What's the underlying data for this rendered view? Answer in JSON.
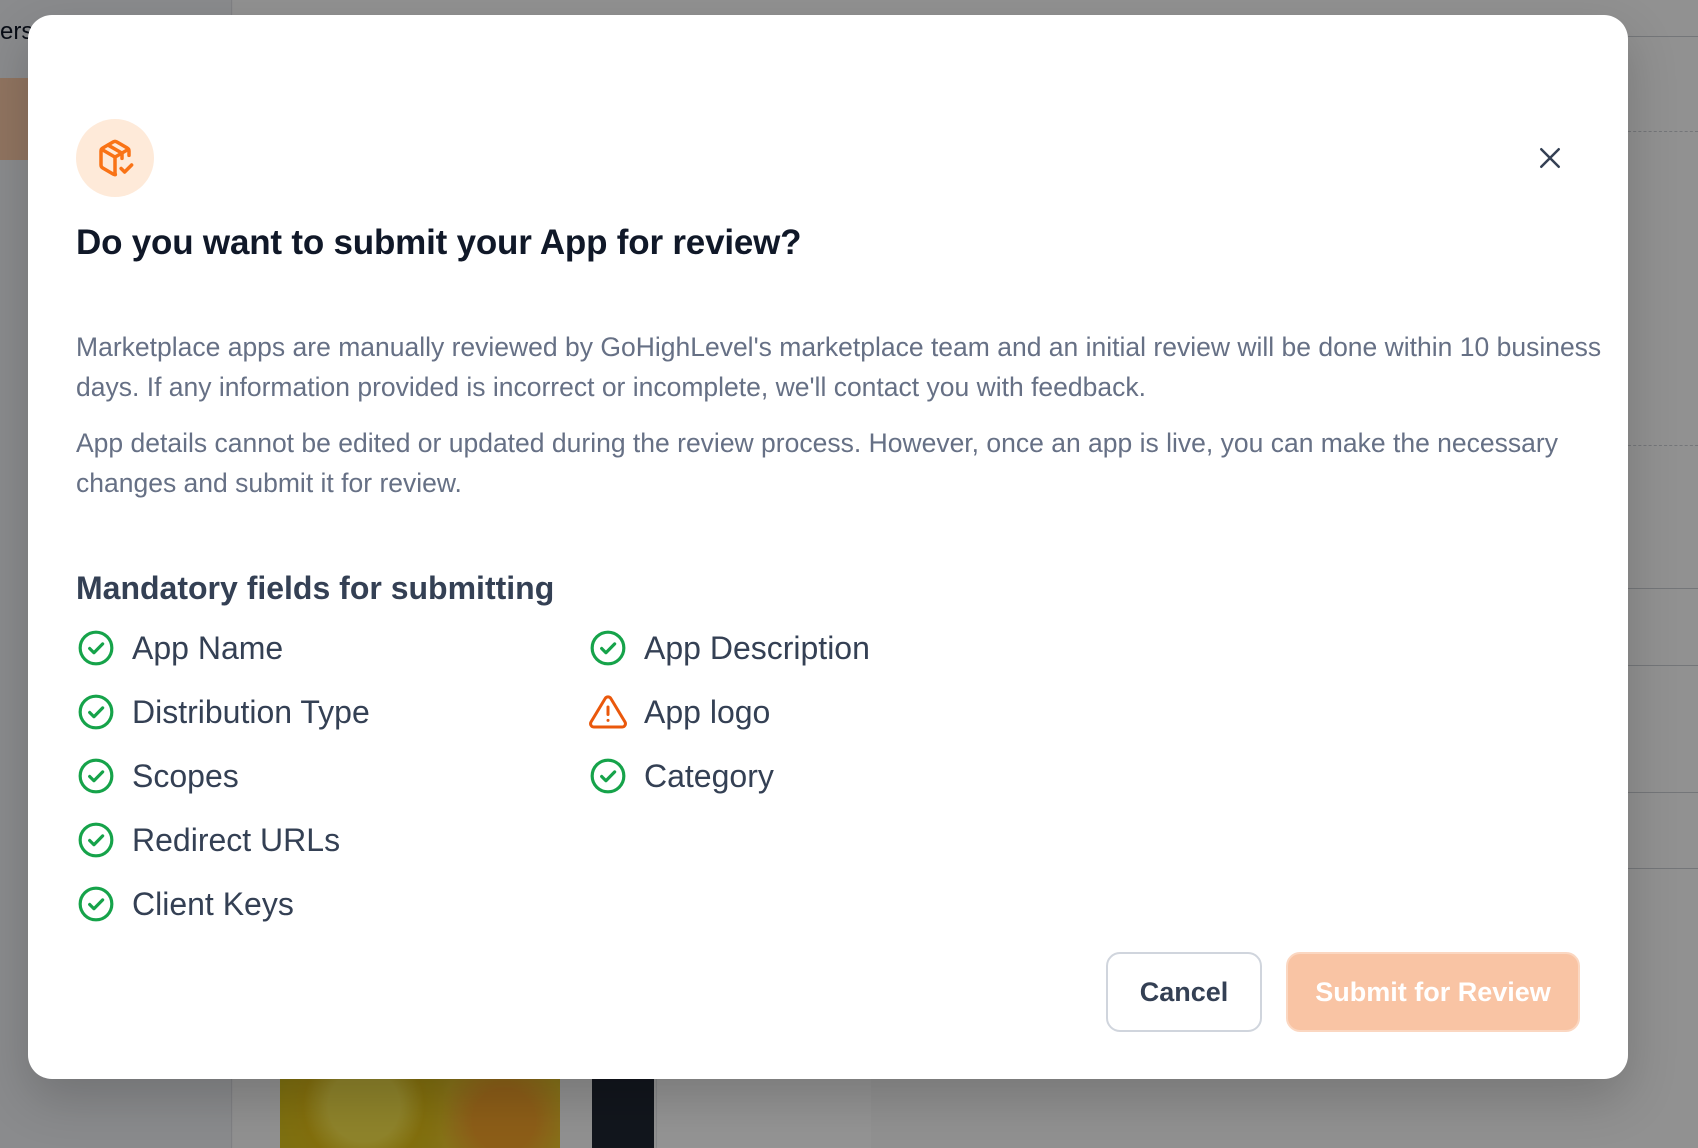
{
  "background": {
    "sidebar_fragment": "ers"
  },
  "modal": {
    "icon": "package-check-icon",
    "close_icon": "close-icon",
    "title": "Do you want to submit your App for review?",
    "description": [
      "Marketplace apps are manually reviewed by GoHighLevel's marketplace team and an initial review will be done within 10 business days. If any information provided is incorrect or incomplete, we'll contact you with feedback.",
      "App details cannot be edited or updated during the review process. However, once an app is live, you can make the necessary changes and submit it for review."
    ],
    "section_title": "Mandatory fields for submitting",
    "fields": [
      {
        "label": "App Name",
        "status": "complete",
        "icon": "check-circle-icon"
      },
      {
        "label": "Distribution Type",
        "status": "complete",
        "icon": "check-circle-icon"
      },
      {
        "label": "Scopes",
        "status": "complete",
        "icon": "check-circle-icon"
      },
      {
        "label": "Redirect URLs",
        "status": "complete",
        "icon": "check-circle-icon"
      },
      {
        "label": "Client Keys",
        "status": "complete",
        "icon": "check-circle-icon"
      },
      {
        "label": "App Description",
        "status": "complete",
        "icon": "check-circle-icon"
      },
      {
        "label": "App logo",
        "status": "warning",
        "icon": "warning-triangle-icon"
      },
      {
        "label": "Category",
        "status": "complete",
        "icon": "check-circle-icon"
      }
    ],
    "buttons": {
      "cancel_label": "Cancel",
      "submit_label": "Submit for Review"
    }
  },
  "colors": {
    "brand": "#f97316",
    "success": "#16a34a",
    "warning": "#ea580c",
    "submit_disabled": "#f9c4a4"
  }
}
